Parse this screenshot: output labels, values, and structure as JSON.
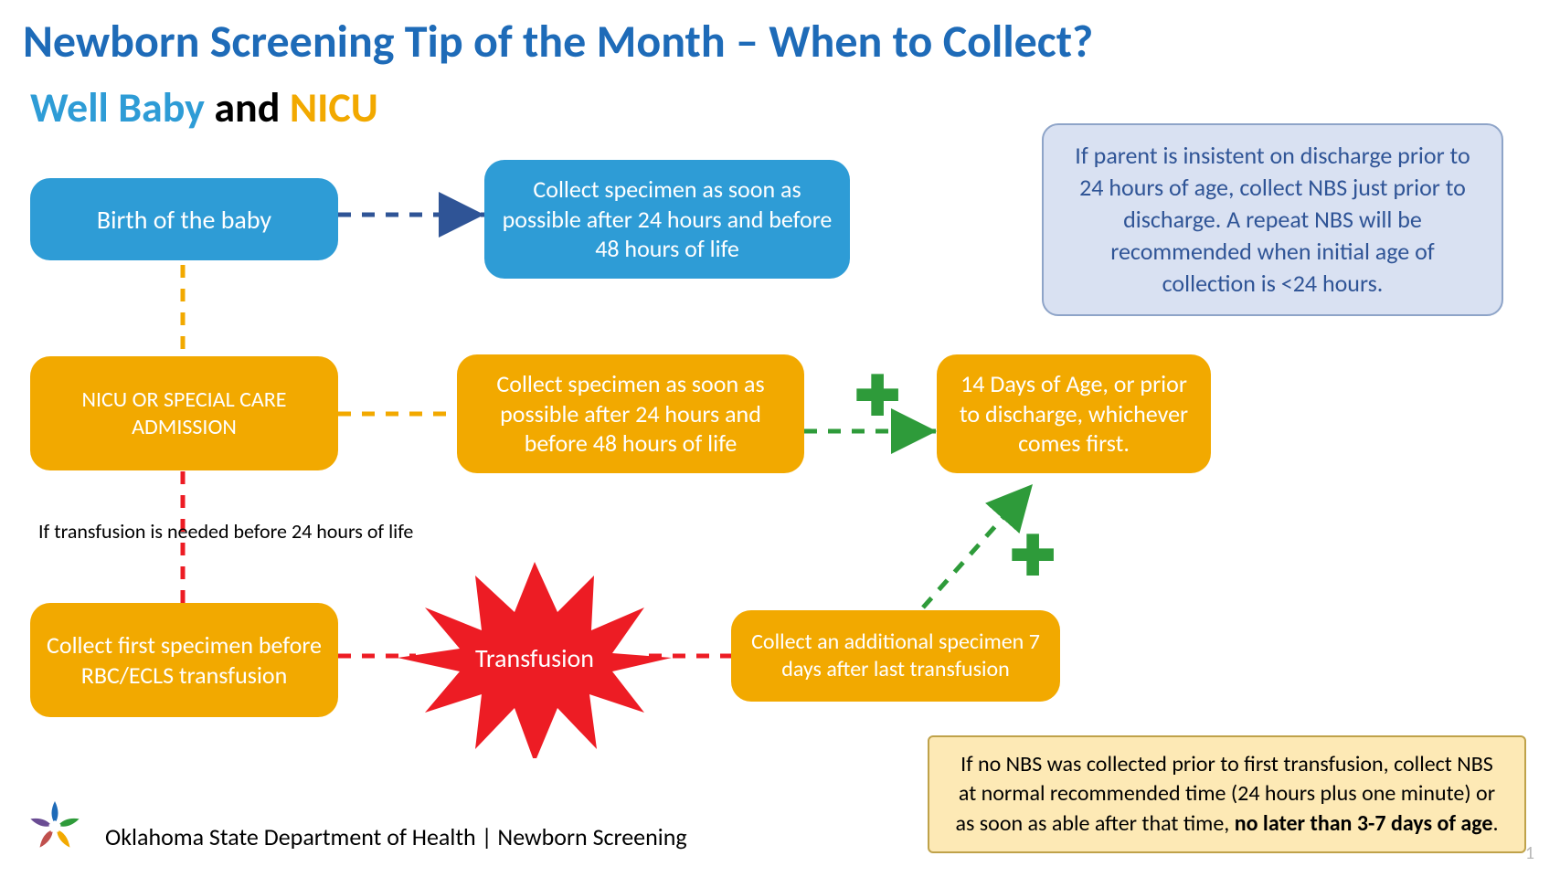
{
  "title": "Newborn Screening Tip of the Month – When to Collect?",
  "subtitle": {
    "well": "Well Baby",
    "and": " and ",
    "nicu": "NICU"
  },
  "boxes": {
    "birth": "Birth of the baby",
    "collect_well": "Collect specimen as soon as possible after 24 hours and before 48 hours of life",
    "nicu_admit": "NICU OR SPECIAL CARE ADMISSION",
    "collect_nicu": "Collect specimen as soon as possible after 24 hours and before 48 hours of life",
    "fourteen": "14 Days of Age, or prior to discharge, whichever comes first.",
    "first_specimen": "Collect first specimen before RBC/ECLS transfusion",
    "additional": "Collect an additional specimen 7 days after last transfusion",
    "transfusion": "Transfusion"
  },
  "notes": {
    "discharge": "If parent is insistent on discharge prior to 24 hours of age, collect NBS just prior to discharge.  A repeat NBS will be recommended when initial age of collection is <24 hours.",
    "no_nbs_pre": "If no NBS was collected prior to first transfusion, collect NBS at normal recommended time (24 hours plus one minute) or as soon as able after that time, ",
    "no_nbs_bold": "no later than 3-7 days of age",
    "no_nbs_post": "."
  },
  "labels": {
    "if_transfusion": "If transfusion is needed before 24 hours of life"
  },
  "footer": "Oklahoma State Department of Health | Newborn Screening",
  "page": "1",
  "colors": {
    "blue": "#2E9CD6",
    "orange": "#F2A900",
    "green": "#2E9B3A",
    "red": "#ED1C24",
    "navy": "#2F5496"
  }
}
